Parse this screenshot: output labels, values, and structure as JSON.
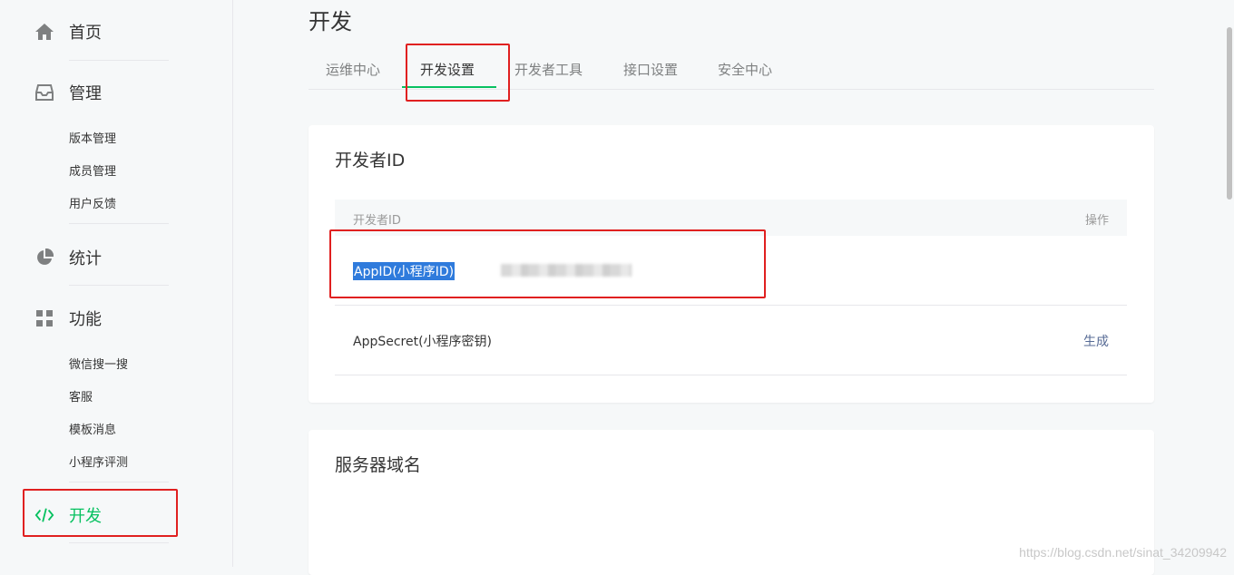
{
  "sidebar": {
    "home": "首页",
    "manage": "管理",
    "manage_items": [
      "版本管理",
      "成员管理",
      "用户反馈"
    ],
    "stats": "统计",
    "features": "功能",
    "feature_items": [
      "微信搜一搜",
      "客服",
      "模板消息",
      "小程序评测"
    ],
    "dev": "开发"
  },
  "main": {
    "title": "开发",
    "tabs": [
      "运维中心",
      "开发设置",
      "开发者工具",
      "接口设置",
      "安全中心"
    ],
    "active_tab": "开发设置"
  },
  "dev_id_card": {
    "title": "开发者ID",
    "col_id": "开发者ID",
    "col_action": "操作",
    "rows": [
      {
        "label": "AppID(小程序ID)",
        "action": ""
      },
      {
        "label": "AppSecret(小程序密钥)",
        "action": "生成"
      }
    ]
  },
  "server_card": {
    "title": "服务器域名"
  },
  "watermark": "https://blog.csdn.net/sinat_34209942",
  "colors": {
    "accent": "#07c160",
    "link": "#576b95",
    "highlight": "#e02020"
  }
}
